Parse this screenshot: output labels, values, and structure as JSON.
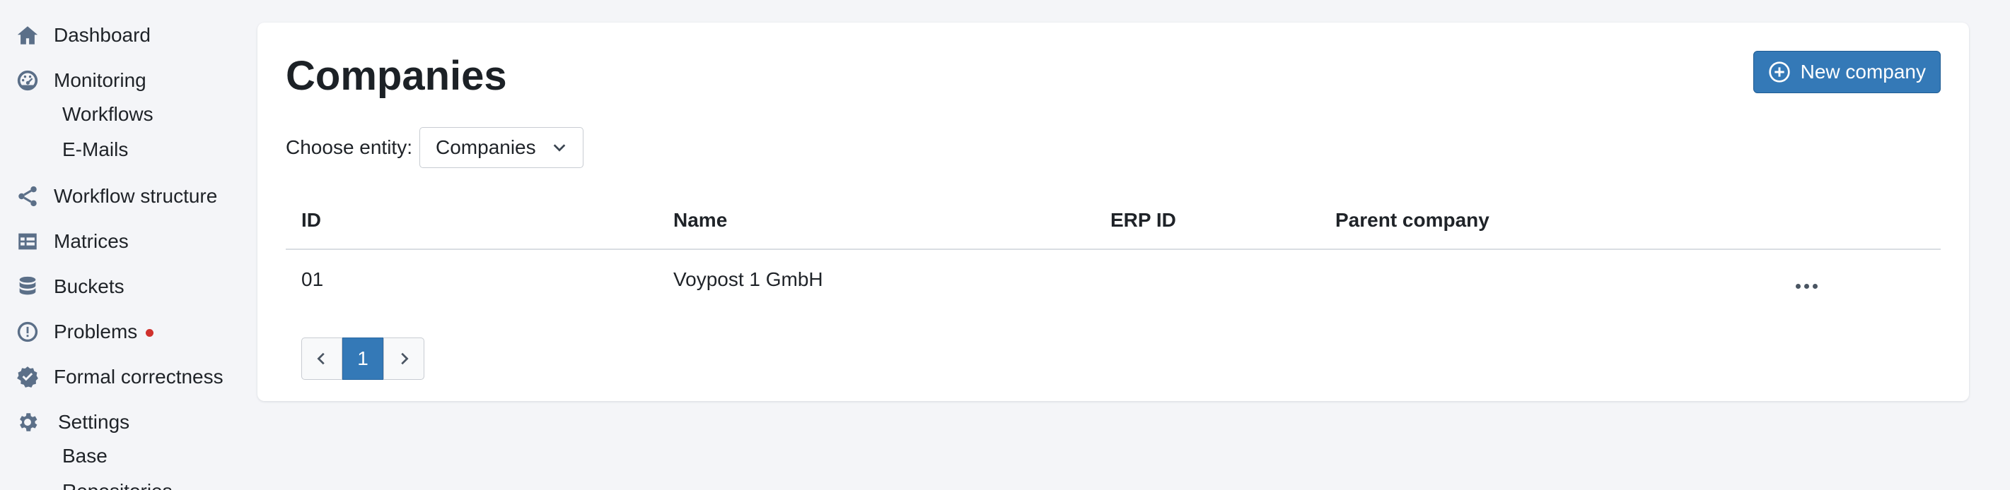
{
  "sidebar": {
    "dashboard": {
      "label": "Dashboard",
      "icon": "home-icon"
    },
    "monitoring": {
      "label": "Monitoring",
      "icon": "gauge-icon"
    },
    "monitoring_sub": [
      "Workflows",
      "E-Mails"
    ],
    "workflow_structure": {
      "label": "Workflow structure",
      "icon": "share-nodes-icon"
    },
    "matrices": {
      "label": "Matrices",
      "icon": "table-icon"
    },
    "buckets": {
      "label": "Buckets",
      "icon": "database-icon"
    },
    "problems": {
      "label": "Problems",
      "icon": "alert-circle-icon",
      "has_alert": true
    },
    "formal_correctness": {
      "label": "Formal correctness",
      "icon": "check-badge-icon"
    },
    "settings": {
      "label": "Settings",
      "icon": "gear-icon"
    },
    "settings_sub": [
      "Base",
      "Repositories"
    ]
  },
  "main": {
    "title": "Companies",
    "new_button_label": "New company",
    "entity_label": "Choose entity:",
    "entity_selected": "Companies",
    "table": {
      "columns": [
        "ID",
        "Name",
        "ERP ID",
        "Parent company"
      ],
      "rows": [
        {
          "id": "01",
          "name": "Voypost 1 GmbH",
          "erp_id": "",
          "parent": ""
        }
      ]
    },
    "pagination": {
      "current_page": "1"
    }
  },
  "colors": {
    "accent": "#3479b7",
    "sidebar_icon": "#5b6f88",
    "alert_dot": "#d0312d",
    "background": "#f4f5f8"
  }
}
